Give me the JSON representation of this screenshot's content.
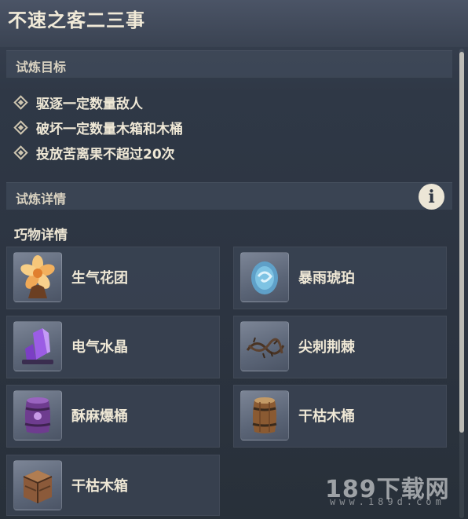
{
  "header": {
    "title": "不速之客二三事"
  },
  "objectives": {
    "label": "试炼目标",
    "items": [
      "驱逐一定数量敌人",
      "破坏一定数量木箱和木桶",
      "投放苦离果不超过20次"
    ]
  },
  "details": {
    "label": "试炼详情",
    "info_icon": "i",
    "subheading": "巧物详情",
    "gadgets": [
      {
        "name": "生气花团",
        "icon": "flower-icon"
      },
      {
        "name": "暴雨琥珀",
        "icon": "amber-icon"
      },
      {
        "name": "电气水晶",
        "icon": "crystal-icon"
      },
      {
        "name": "尖刺荆棘",
        "icon": "thorn-icon"
      },
      {
        "name": "酥麻爆桶",
        "icon": "purple-barrel-icon"
      },
      {
        "name": "干枯木桶",
        "icon": "wood-barrel-icon"
      },
      {
        "name": "干枯木箱",
        "icon": "wood-crate-icon"
      }
    ]
  },
  "watermark": {
    "text": "189下载网",
    "url": "www.189d.com"
  }
}
